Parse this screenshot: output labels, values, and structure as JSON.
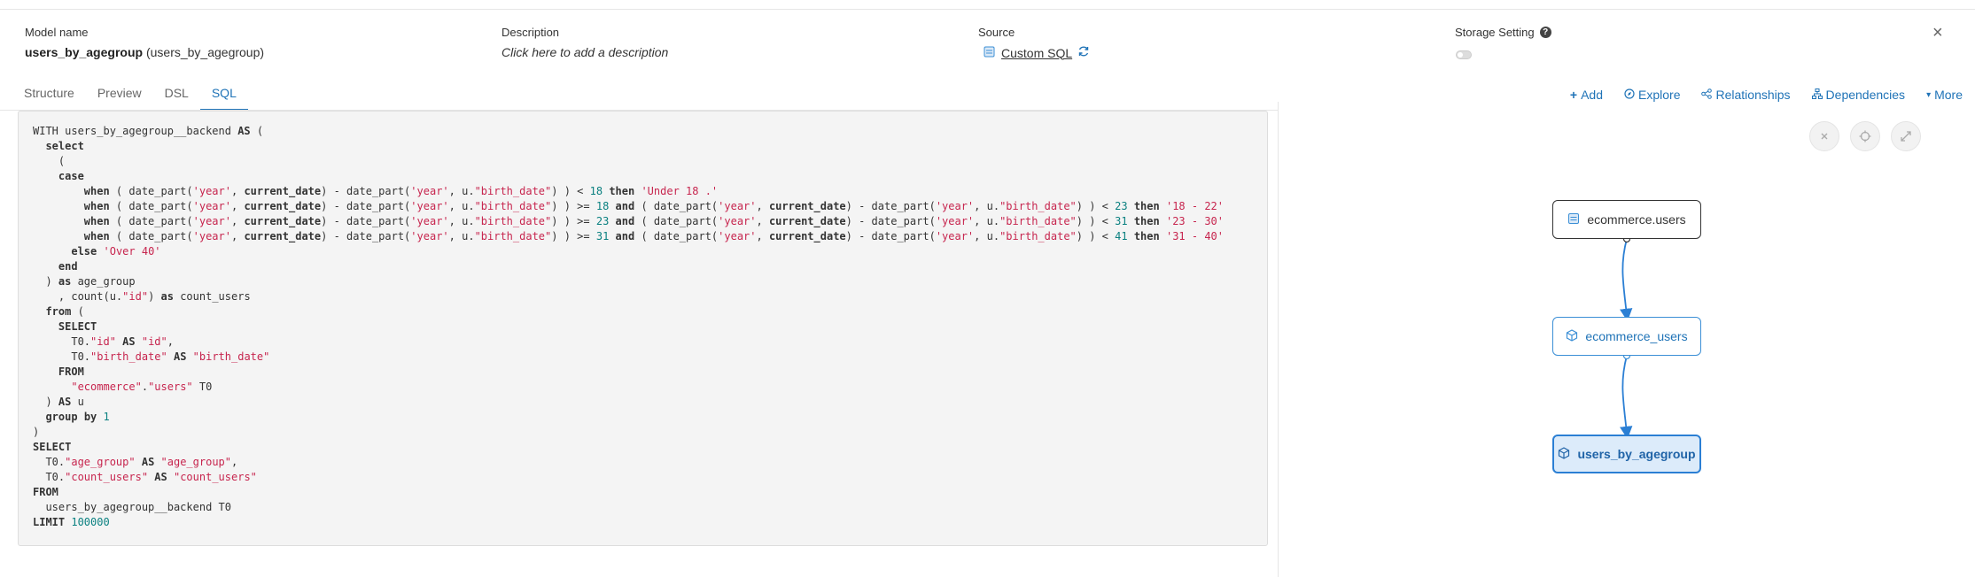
{
  "header": {
    "model_name_label": "Model name",
    "model_name": "users_by_agegroup",
    "model_name_alias": "(users_by_agegroup)",
    "description_label": "Description",
    "description_placeholder": "Click here to add a description",
    "source_label": "Source",
    "source_value": "Custom SQL",
    "storage_label": "Storage Setting",
    "storage_enabled": false
  },
  "tabs": [
    {
      "label": "Structure",
      "active": false
    },
    {
      "label": "Preview",
      "active": false
    },
    {
      "label": "DSL",
      "active": false
    },
    {
      "label": "SQL",
      "active": true
    }
  ],
  "actions": {
    "add": "Add",
    "explore": "Explore",
    "relationships": "Relationships",
    "dependencies": "Dependencies",
    "more": "More"
  },
  "sql_lines": [
    "WITH users_by_agegroup__backend AS (",
    "  select",
    "    (",
    "    case",
    "        when ( date_part('year', current_date) - date_part('year', u.\"birth_date\") ) < 18 then 'Under 18 .'",
    "        when ( date_part('year', current_date) - date_part('year', u.\"birth_date\") ) >= 18 and ( date_part('year', current_date) - date_part('year', u.\"birth_date\") ) < 23 then '18 - 22'",
    "        when ( date_part('year', current_date) - date_part('year', u.\"birth_date\") ) >= 23 and ( date_part('year', current_date) - date_part('year', u.\"birth_date\") ) < 31 then '23 - 30'",
    "        when ( date_part('year', current_date) - date_part('year', u.\"birth_date\") ) >= 31 and ( date_part('year', current_date) - date_part('year', u.\"birth_date\") ) < 41 then '31 - 40'",
    "      else 'Over 40'",
    "    end",
    "  ) as age_group",
    "    , count(u.\"id\") as count_users",
    "  from (",
    "    SELECT",
    "      T0.\"id\" AS \"id\",",
    "      T0.\"birth_date\" AS \"birth_date\"",
    "    FROM",
    "      \"ecommerce\".\"users\" T0",
    "  ) AS u",
    "  group by 1",
    ")",
    "SELECT",
    "  T0.\"age_group\" AS \"age_group\",",
    "  T0.\"count_users\" AS \"count_users\"",
    "FROM",
    "  users_by_agegroup__backend T0",
    "LIMIT 100000"
  ],
  "diagram": {
    "nodes": [
      {
        "label": "ecommerce.users",
        "icon": "table-icon"
      },
      {
        "label": "ecommerce_users",
        "icon": "cube-icon"
      },
      {
        "label": "users_by_agegroup",
        "icon": "cube-icon",
        "selected": true
      }
    ],
    "controls": [
      "close-icon",
      "crosshair-icon",
      "expand-icon"
    ]
  },
  "colors": {
    "accent": "#1f73b7",
    "sql_string": "#c7254e",
    "sql_number": "#0a8080"
  }
}
